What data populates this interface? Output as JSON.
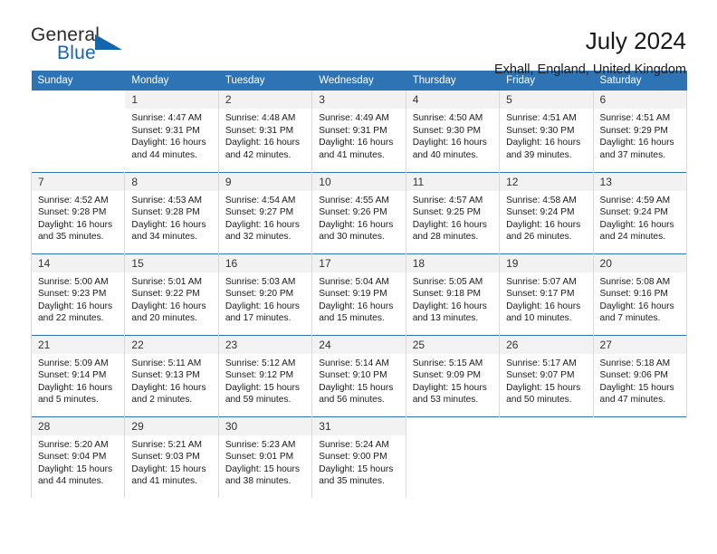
{
  "brand": {
    "name_top": "General",
    "name_bottom": "Blue"
  },
  "header": {
    "title": "July 2024",
    "subtitle": "Exhall, England, United Kingdom"
  },
  "theme": {
    "header_blue": "#2e74b5",
    "daynum_gray": "#f2f2f2",
    "brand_blue": "#1565b5"
  },
  "weekday_headers": [
    "Sunday",
    "Monday",
    "Tuesday",
    "Wednesday",
    "Thursday",
    "Friday",
    "Saturday"
  ],
  "weeks": [
    [
      {
        "day": "",
        "sunrise": "",
        "sunset": "",
        "daylight1": "",
        "daylight2": ""
      },
      {
        "day": "1",
        "sunrise": "Sunrise: 4:47 AM",
        "sunset": "Sunset: 9:31 PM",
        "daylight1": "Daylight: 16 hours",
        "daylight2": "and 44 minutes."
      },
      {
        "day": "2",
        "sunrise": "Sunrise: 4:48 AM",
        "sunset": "Sunset: 9:31 PM",
        "daylight1": "Daylight: 16 hours",
        "daylight2": "and 42 minutes."
      },
      {
        "day": "3",
        "sunrise": "Sunrise: 4:49 AM",
        "sunset": "Sunset: 9:31 PM",
        "daylight1": "Daylight: 16 hours",
        "daylight2": "and 41 minutes."
      },
      {
        "day": "4",
        "sunrise": "Sunrise: 4:50 AM",
        "sunset": "Sunset: 9:30 PM",
        "daylight1": "Daylight: 16 hours",
        "daylight2": "and 40 minutes."
      },
      {
        "day": "5",
        "sunrise": "Sunrise: 4:51 AM",
        "sunset": "Sunset: 9:30 PM",
        "daylight1": "Daylight: 16 hours",
        "daylight2": "and 39 minutes."
      },
      {
        "day": "6",
        "sunrise": "Sunrise: 4:51 AM",
        "sunset": "Sunset: 9:29 PM",
        "daylight1": "Daylight: 16 hours",
        "daylight2": "and 37 minutes."
      }
    ],
    [
      {
        "day": "7",
        "sunrise": "Sunrise: 4:52 AM",
        "sunset": "Sunset: 9:28 PM",
        "daylight1": "Daylight: 16 hours",
        "daylight2": "and 35 minutes."
      },
      {
        "day": "8",
        "sunrise": "Sunrise: 4:53 AM",
        "sunset": "Sunset: 9:28 PM",
        "daylight1": "Daylight: 16 hours",
        "daylight2": "and 34 minutes."
      },
      {
        "day": "9",
        "sunrise": "Sunrise: 4:54 AM",
        "sunset": "Sunset: 9:27 PM",
        "daylight1": "Daylight: 16 hours",
        "daylight2": "and 32 minutes."
      },
      {
        "day": "10",
        "sunrise": "Sunrise: 4:55 AM",
        "sunset": "Sunset: 9:26 PM",
        "daylight1": "Daylight: 16 hours",
        "daylight2": "and 30 minutes."
      },
      {
        "day": "11",
        "sunrise": "Sunrise: 4:57 AM",
        "sunset": "Sunset: 9:25 PM",
        "daylight1": "Daylight: 16 hours",
        "daylight2": "and 28 minutes."
      },
      {
        "day": "12",
        "sunrise": "Sunrise: 4:58 AM",
        "sunset": "Sunset: 9:24 PM",
        "daylight1": "Daylight: 16 hours",
        "daylight2": "and 26 minutes."
      },
      {
        "day": "13",
        "sunrise": "Sunrise: 4:59 AM",
        "sunset": "Sunset: 9:24 PM",
        "daylight1": "Daylight: 16 hours",
        "daylight2": "and 24 minutes."
      }
    ],
    [
      {
        "day": "14",
        "sunrise": "Sunrise: 5:00 AM",
        "sunset": "Sunset: 9:23 PM",
        "daylight1": "Daylight: 16 hours",
        "daylight2": "and 22 minutes."
      },
      {
        "day": "15",
        "sunrise": "Sunrise: 5:01 AM",
        "sunset": "Sunset: 9:22 PM",
        "daylight1": "Daylight: 16 hours",
        "daylight2": "and 20 minutes."
      },
      {
        "day": "16",
        "sunrise": "Sunrise: 5:03 AM",
        "sunset": "Sunset: 9:20 PM",
        "daylight1": "Daylight: 16 hours",
        "daylight2": "and 17 minutes."
      },
      {
        "day": "17",
        "sunrise": "Sunrise: 5:04 AM",
        "sunset": "Sunset: 9:19 PM",
        "daylight1": "Daylight: 16 hours",
        "daylight2": "and 15 minutes."
      },
      {
        "day": "18",
        "sunrise": "Sunrise: 5:05 AM",
        "sunset": "Sunset: 9:18 PM",
        "daylight1": "Daylight: 16 hours",
        "daylight2": "and 13 minutes."
      },
      {
        "day": "19",
        "sunrise": "Sunrise: 5:07 AM",
        "sunset": "Sunset: 9:17 PM",
        "daylight1": "Daylight: 16 hours",
        "daylight2": "and 10 minutes."
      },
      {
        "day": "20",
        "sunrise": "Sunrise: 5:08 AM",
        "sunset": "Sunset: 9:16 PM",
        "daylight1": "Daylight: 16 hours",
        "daylight2": "and 7 minutes."
      }
    ],
    [
      {
        "day": "21",
        "sunrise": "Sunrise: 5:09 AM",
        "sunset": "Sunset: 9:14 PM",
        "daylight1": "Daylight: 16 hours",
        "daylight2": "and 5 minutes."
      },
      {
        "day": "22",
        "sunrise": "Sunrise: 5:11 AM",
        "sunset": "Sunset: 9:13 PM",
        "daylight1": "Daylight: 16 hours",
        "daylight2": "and 2 minutes."
      },
      {
        "day": "23",
        "sunrise": "Sunrise: 5:12 AM",
        "sunset": "Sunset: 9:12 PM",
        "daylight1": "Daylight: 15 hours",
        "daylight2": "and 59 minutes."
      },
      {
        "day": "24",
        "sunrise": "Sunrise: 5:14 AM",
        "sunset": "Sunset: 9:10 PM",
        "daylight1": "Daylight: 15 hours",
        "daylight2": "and 56 minutes."
      },
      {
        "day": "25",
        "sunrise": "Sunrise: 5:15 AM",
        "sunset": "Sunset: 9:09 PM",
        "daylight1": "Daylight: 15 hours",
        "daylight2": "and 53 minutes."
      },
      {
        "day": "26",
        "sunrise": "Sunrise: 5:17 AM",
        "sunset": "Sunset: 9:07 PM",
        "daylight1": "Daylight: 15 hours",
        "daylight2": "and 50 minutes."
      },
      {
        "day": "27",
        "sunrise": "Sunrise: 5:18 AM",
        "sunset": "Sunset: 9:06 PM",
        "daylight1": "Daylight: 15 hours",
        "daylight2": "and 47 minutes."
      }
    ],
    [
      {
        "day": "28",
        "sunrise": "Sunrise: 5:20 AM",
        "sunset": "Sunset: 9:04 PM",
        "daylight1": "Daylight: 15 hours",
        "daylight2": "and 44 minutes."
      },
      {
        "day": "29",
        "sunrise": "Sunrise: 5:21 AM",
        "sunset": "Sunset: 9:03 PM",
        "daylight1": "Daylight: 15 hours",
        "daylight2": "and 41 minutes."
      },
      {
        "day": "30",
        "sunrise": "Sunrise: 5:23 AM",
        "sunset": "Sunset: 9:01 PM",
        "daylight1": "Daylight: 15 hours",
        "daylight2": "and 38 minutes."
      },
      {
        "day": "31",
        "sunrise": "Sunrise: 5:24 AM",
        "sunset": "Sunset: 9:00 PM",
        "daylight1": "Daylight: 15 hours",
        "daylight2": "and 35 minutes."
      },
      {
        "day": "",
        "sunrise": "",
        "sunset": "",
        "daylight1": "",
        "daylight2": ""
      },
      {
        "day": "",
        "sunrise": "",
        "sunset": "",
        "daylight1": "",
        "daylight2": ""
      },
      {
        "day": "",
        "sunrise": "",
        "sunset": "",
        "daylight1": "",
        "daylight2": ""
      }
    ]
  ]
}
